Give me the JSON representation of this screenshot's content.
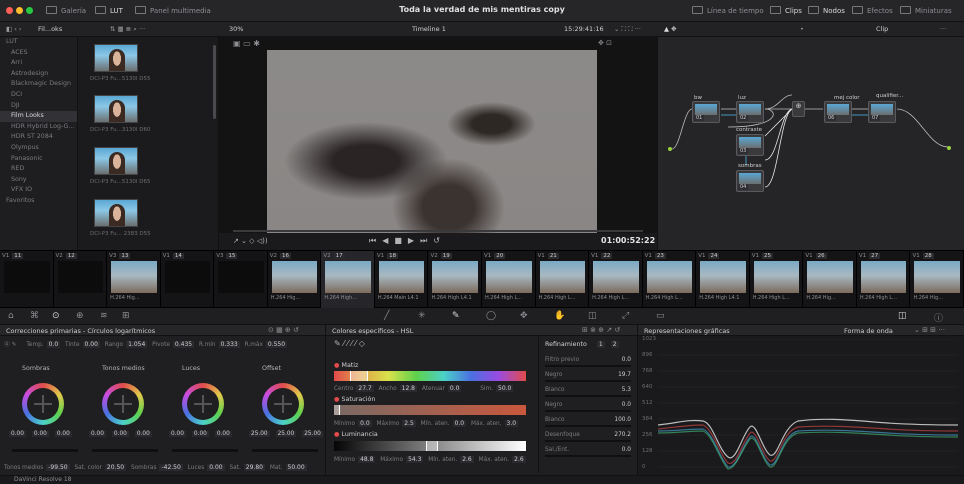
{
  "window": {
    "title": "Toda la verdad de mis mentiras copy"
  },
  "topbar": {
    "left": [
      "Galería",
      "LUT",
      "Panel multimedia"
    ],
    "right": [
      "Línea de tiempo",
      "Clips",
      "Nodos",
      "Efectos",
      "Miniaturas"
    ]
  },
  "bar2": {
    "folder": "Fil...oks",
    "zoom": "30%",
    "timeline": "Timeline 1",
    "timecode": "15:29:41:16",
    "clip": "Clip"
  },
  "lut": {
    "items": [
      "LUT",
      "ACES",
      "Arri",
      "Astrodesign",
      "Blackmagic Design",
      "DCI",
      "DJI",
      "Film Looks",
      "HDR Hybrid Log-G...",
      "HDR ST 2084",
      "Olympus",
      "Panasonic",
      "RED",
      "Sony",
      "VFX IO",
      "Favoritos"
    ],
    "selected": "Film Looks"
  },
  "thumbs": [
    "DCI-P3 Fu...5130I D55",
    "DCI-P3 Fu...3130I D60",
    "DCI-P3 Fu...5130I D65",
    "DCI-P3 Fu... 2383 D55"
  ],
  "viewer": {
    "timecode": "01:00:52:22"
  },
  "nodes": {
    "labels": [
      "bw",
      "luz",
      "mej color",
      "qualifier...",
      "contraste",
      "sombras"
    ],
    "numbers": [
      "01",
      "02",
      "03",
      "04",
      "06",
      "07"
    ]
  },
  "strip": {
    "clips": [
      {
        "v": "V1",
        "n": "11",
        "cap": ""
      },
      {
        "v": "V2",
        "n": "12",
        "cap": ""
      },
      {
        "v": "V3",
        "n": "13",
        "cap": "H.264 Hig..."
      },
      {
        "v": "V1",
        "n": "14",
        "cap": ""
      },
      {
        "v": "V3",
        "n": "15",
        "cap": ""
      },
      {
        "v": "V2",
        "n": "16",
        "cap": "H.264 Hig..."
      },
      {
        "v": "V2",
        "n": "17",
        "cap": "H.264 High..."
      },
      {
        "v": "V1",
        "n": "18",
        "cap": "H.264 Main L4.1"
      },
      {
        "v": "V2",
        "n": "19",
        "cap": "H.264 High L4.1"
      },
      {
        "v": "V1",
        "n": "20",
        "cap": "H.264 High L..."
      },
      {
        "v": "V1",
        "n": "21",
        "cap": "H.264 High L..."
      },
      {
        "v": "V1",
        "n": "22",
        "cap": "H.264 High L..."
      },
      {
        "v": "V1",
        "n": "23",
        "cap": "H.264 High L..."
      },
      {
        "v": "V1",
        "n": "24",
        "cap": "H.264 High L4.1"
      },
      {
        "v": "V1",
        "n": "25",
        "cap": "H.264 High L..."
      },
      {
        "v": "V1",
        "n": "26",
        "cap": "H.264 Hig..."
      },
      {
        "v": "V1",
        "n": "27",
        "cap": "H.264 High L..."
      },
      {
        "v": "V1",
        "n": "28",
        "cap": "H.264 Hig..."
      }
    ]
  },
  "primaries": {
    "title": "Correcciones primarias - Círculos logarítmicos",
    "top": {
      "temp_label": "Temp.",
      "temp": "0.0",
      "tint_label": "Tinte",
      "tint": "0.00",
      "rango_label": "Rango",
      "rango": "1.054",
      "pivot_label": "Pivote",
      "pivot": "0.435",
      "rlow_label": "R.mín",
      "rlow": "0.333",
      "rhigh_label": "R.máx",
      "rhigh": "0.550"
    },
    "wheels": [
      {
        "name": "Sombras",
        "v": [
          "0.00",
          "0.00",
          "0.00"
        ]
      },
      {
        "name": "Tonos medios",
        "v": [
          "0.00",
          "0.00",
          "0.00"
        ]
      },
      {
        "name": "Luces",
        "v": [
          "0.00",
          "0.00",
          "0.00"
        ]
      },
      {
        "name": "Offset",
        "v": [
          "25.00",
          "25.00",
          "25.00"
        ]
      }
    ],
    "bottom": {
      "a_label": "Tonos medios",
      "a": "-99.50",
      "b_label": "Sat. color",
      "b": "20.50",
      "c_label": "Sombras",
      "c": "-42.50",
      "d_label": "Luces",
      "d": "0.00",
      "e_label": "Sat.",
      "e": "29.80",
      "f_label": "Mat.",
      "f": "50.00"
    }
  },
  "hsl": {
    "title": "Colores específicos - HSL",
    "matiz": {
      "label": "Matiz",
      "centro_label": "Centro",
      "centro": "27.7",
      "ancho_label": "Ancho",
      "ancho": "12.8",
      "atenuar_label": "Atenuar",
      "atenuar": "0.0",
      "sim_label": "Sim.",
      "sim": "50.0"
    },
    "saturacion": {
      "label": "Saturación",
      "min_label": "Mínimo",
      "min": "0.0",
      "max_label": "Máximo",
      "max": "2.5",
      "minat_label": "Mín. aten.",
      "minat": "0.0",
      "maxat_label": "Máx. aten.",
      "maxat": "3.0"
    },
    "luminancia": {
      "label": "Luminancia",
      "min_label": "Mínimo",
      "min": "48.8",
      "max_label": "Máximo",
      "max": "54.3",
      "minat_label": "Mín. aten.",
      "minat": "2.6",
      "maxat_label": "Máx. aten.",
      "maxat": "2.6"
    },
    "refine": {
      "title": "Refinamiento",
      "tabs": [
        "1",
        "2"
      ],
      "rows": [
        {
          "label": "Filtro previo",
          "value": "0.0"
        },
        {
          "label": "Negro",
          "value": "19.7"
        },
        {
          "label": "Blanco",
          "value": "5.3"
        },
        {
          "label": "Negro",
          "value": "0.0"
        },
        {
          "label": "Blanco",
          "value": "100.0"
        },
        {
          "label": "Desenfoque",
          "value": "270.2"
        },
        {
          "label": "Sal./Ent.",
          "value": "0.0"
        }
      ]
    }
  },
  "scope": {
    "title": "Representaciones gráficas",
    "mode": "Forma de onda",
    "ticks": [
      "1023",
      "896",
      "768",
      "640",
      "512",
      "384",
      "256",
      "128",
      "0"
    ]
  },
  "status": {
    "app": "DaVinci Resolve 18"
  }
}
